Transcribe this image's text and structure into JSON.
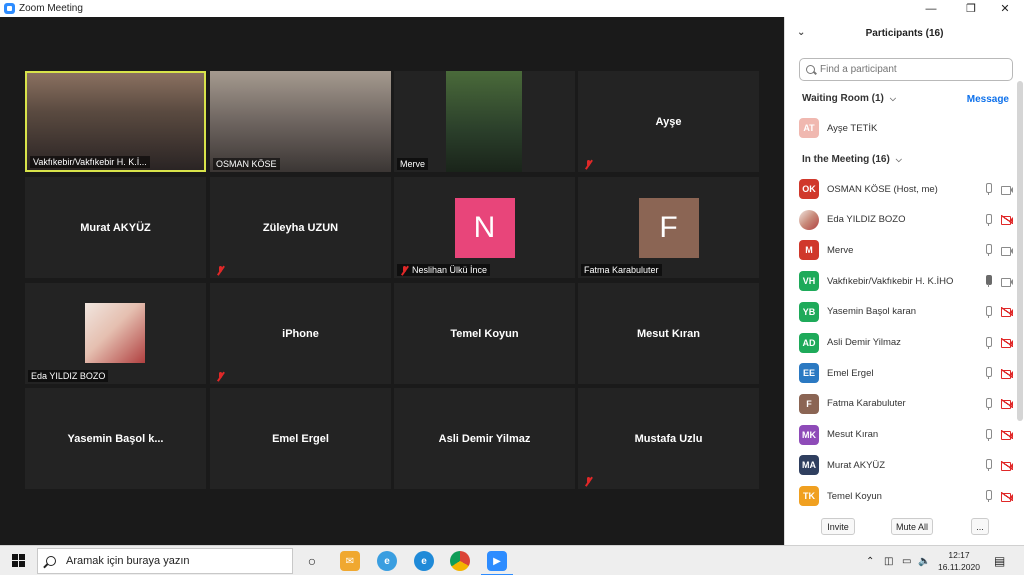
{
  "window": {
    "title": "Zoom Meeting"
  },
  "tiles": [
    {
      "name": "Vakfıkebir/Vakfıkebir H. K.İ...",
      "type": "video",
      "active": true,
      "muted": false
    },
    {
      "name": "OSMAN KÖSE",
      "type": "video",
      "active": false,
      "muted": false
    },
    {
      "name": "Merve",
      "type": "video",
      "active": false,
      "muted": false
    },
    {
      "name": "Ayşe",
      "type": "name",
      "muted": true
    },
    {
      "name": "Murat AKYÜZ",
      "type": "name",
      "muted": false
    },
    {
      "name": "Züleyha UZUN",
      "type": "name",
      "muted": true
    },
    {
      "name": "Neslihan Ülkü İnce",
      "type": "avatar",
      "initial": "N",
      "color": "#e8457a",
      "muted": true
    },
    {
      "name": "Fatma Karabuluter",
      "type": "avatar",
      "initial": "F",
      "color": "#8b6554",
      "muted": false
    },
    {
      "name": "Eda YILDIZ BOZO",
      "type": "photo",
      "muted": false
    },
    {
      "name": "iPhone",
      "type": "name",
      "muted": true
    },
    {
      "name": "Temel Koyun",
      "type": "name",
      "muted": false
    },
    {
      "name": "Mesut Kıran",
      "type": "name",
      "muted": false
    },
    {
      "name": "Yasemin  Başol  k...",
      "type": "name",
      "muted": false
    },
    {
      "name": "Emel Ergel",
      "type": "name",
      "muted": false
    },
    {
      "name": "Asli Demir Yilmaz",
      "type": "name",
      "muted": false
    },
    {
      "name": "Mustafa Uzlu",
      "type": "name",
      "muted": true
    }
  ],
  "panel": {
    "title": "Participants (16)",
    "search_placeholder": "Find a participant",
    "waiting_room_label": "Waiting Room (1)",
    "message_label": "Message",
    "waiting": [
      {
        "initials": "AT",
        "name": "Ayşe TETİK",
        "color": "#f0b8b0"
      }
    ],
    "in_meeting_label": "In the Meeting (16)",
    "participants": [
      {
        "initials": "OK",
        "name": "OSMAN KÖSE (Host, me)",
        "color": "#d0382b",
        "cam": "on",
        "talking": false
      },
      {
        "initials": "",
        "name": "Eda YILDIZ BOZO",
        "color": "#c88a7a",
        "cam": "off",
        "talking": false,
        "photo": true
      },
      {
        "initials": "M",
        "name": "Merve",
        "color": "#d0382b",
        "cam": "on",
        "talking": false
      },
      {
        "initials": "VH",
        "name": "Vakfıkebir/Vakfıkebir H. K.İHO",
        "color": "#1eaa5a",
        "cam": "on",
        "talking": true
      },
      {
        "initials": "YB",
        "name": "Yasemin Başol karan",
        "color": "#1eaa5a",
        "cam": "off",
        "talking": false
      },
      {
        "initials": "AD",
        "name": "Asli Demir Yilmaz",
        "color": "#1eaa5a",
        "cam": "off",
        "talking": false
      },
      {
        "initials": "EE",
        "name": "Emel Ergel",
        "color": "#2b79c2",
        "cam": "off",
        "talking": false
      },
      {
        "initials": "F",
        "name": "Fatma Karabuluter",
        "color": "#8b6554",
        "cam": "off",
        "talking": false
      },
      {
        "initials": "MK",
        "name": "Mesut Kıran",
        "color": "#8e4bb8",
        "cam": "off",
        "talking": false
      },
      {
        "initials": "MA",
        "name": "Murat AKYÜZ",
        "color": "#2f3f5f",
        "cam": "off",
        "talking": false
      },
      {
        "initials": "TK",
        "name": "Temel Koyun",
        "color": "#f0a020",
        "cam": "off",
        "talking": false
      }
    ],
    "footer": {
      "invite": "Invite",
      "mute_all": "Mute All",
      "more": "..."
    }
  },
  "taskbar": {
    "search_placeholder": "Aramak için buraya yazın",
    "time": "12:17",
    "date": "16.11.2020"
  },
  "colors": {
    "accent": "#2d8cff",
    "active_speaker": "#d8e34a",
    "muted": "#e02828"
  }
}
